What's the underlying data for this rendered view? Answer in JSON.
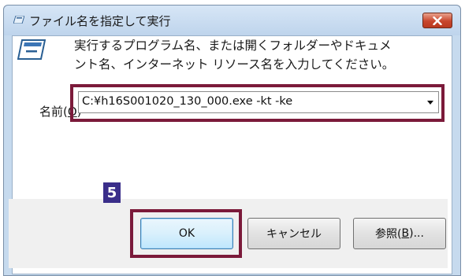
{
  "window": {
    "title": "ファイル名を指定して実行",
    "close_icon": "close-icon"
  },
  "message": {
    "line1": "実行するプログラム名、または開くフォルダーやドキュメ",
    "line2": "ント名、インターネット リソース名を入力してください。"
  },
  "open_field": {
    "label_prefix": "名前(",
    "label_accel": "O",
    "label_suffix": ")",
    "value": "C:¥h16S001020_130_000.exe -kt -ke"
  },
  "step_badge": "5",
  "buttons": {
    "ok": "OK",
    "cancel": "キャンセル",
    "browse_prefix": "参照(",
    "browse_accel": "B",
    "browse_suffix": ")..."
  },
  "colors": {
    "highlight": "#7b1a3a",
    "badge": "#3a2e8a"
  }
}
